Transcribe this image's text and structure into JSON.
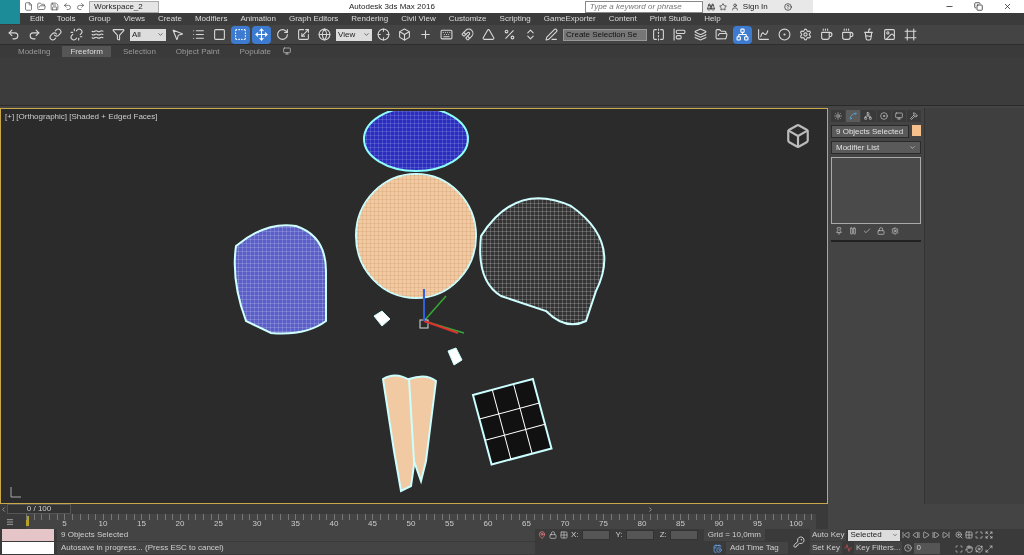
{
  "title_bar": {
    "workspace": "Workspace_2",
    "title": "Autodesk 3ds Max 2016",
    "search_placeholder": "Type a keyword or phrase",
    "sign_in": "Sign In"
  },
  "menu": [
    "Edit",
    "Tools",
    "Group",
    "Views",
    "Create",
    "Modifiers",
    "Animation",
    "Graph Editors",
    "Rendering",
    "Civil View",
    "Customize",
    "Scripting",
    "GameExporter",
    "Content",
    "Print Studio",
    "Help"
  ],
  "toolbar": {
    "selection_filter": "All",
    "reference_coord": "View",
    "selection_set": "Create Selection Se",
    "tools": [
      {
        "kind": "undo",
        "selected": false
      },
      {
        "kind": "redo",
        "selected": false
      },
      {
        "kind": "link",
        "selected": false
      },
      {
        "kind": "unlink",
        "selected": false
      },
      {
        "kind": "bind",
        "selected": false
      },
      {
        "kind": "filter",
        "selected": false
      },
      {
        "kind": "select",
        "selected": false
      },
      {
        "kind": "list",
        "selected": false
      },
      {
        "kind": "region",
        "selected": false
      },
      {
        "kind": "window",
        "selected": true
      },
      {
        "kind": "move",
        "selected": true
      },
      {
        "kind": "rotate",
        "selected": false
      },
      {
        "kind": "scale",
        "selected": false
      },
      {
        "kind": "place",
        "selected": false
      },
      {
        "kind": "coord",
        "selected": false
      },
      {
        "kind": "pivot",
        "selected": false
      },
      {
        "kind": "manip",
        "selected": false
      },
      {
        "kind": "keyboard",
        "selected": false
      },
      {
        "kind": "snap",
        "selected": false
      },
      {
        "kind": "angle",
        "selected": false
      },
      {
        "kind": "percent",
        "selected": false
      },
      {
        "kind": "spinner",
        "selected": false
      },
      {
        "kind": "edit",
        "selected": false
      },
      {
        "kind": "mirror",
        "selected": false
      },
      {
        "kind": "align",
        "selected": false
      },
      {
        "kind": "layers",
        "selected": false
      },
      {
        "kind": "explorer",
        "selected": false
      },
      {
        "kind": "schematic",
        "selected": true
      },
      {
        "kind": "curve",
        "selected": false
      },
      {
        "kind": "material",
        "selected": false
      },
      {
        "kind": "render_setup",
        "selected": false
      },
      {
        "kind": "render",
        "selected": false
      },
      {
        "kind": "render2",
        "selected": false
      },
      {
        "kind": "render3",
        "selected": false
      },
      {
        "kind": "render4",
        "selected": false
      },
      {
        "kind": "frame",
        "selected": false
      }
    ]
  },
  "ribbon_tabs": [
    {
      "label": "Modeling",
      "selected": false
    },
    {
      "label": "Freeform",
      "selected": true
    },
    {
      "label": "Selection",
      "selected": false
    },
    {
      "label": "Object Paint",
      "selected": false
    },
    {
      "label": "Populate",
      "selected": false
    }
  ],
  "viewport": {
    "label": "[+] [Orthographic] [Shaded + Edged Faces]"
  },
  "command_panel": {
    "tabs": [
      {
        "kind": "create",
        "selected": false
      },
      {
        "kind": "modify",
        "selected": true
      },
      {
        "kind": "hierarchy",
        "selected": false
      },
      {
        "kind": "motion",
        "selected": false
      },
      {
        "kind": "display",
        "selected": false
      },
      {
        "kind": "utilities",
        "selected": false
      }
    ],
    "object_name": "9 Objects Selected",
    "modifier_list": "Modifier List"
  },
  "timeline": {
    "frame": "0 / 100",
    "ticks": [
      "5",
      "10",
      "15",
      "20",
      "25",
      "30",
      "35",
      "40",
      "45",
      "50",
      "55",
      "60",
      "65",
      "70",
      "75",
      "80",
      "85",
      "90",
      "95",
      "100"
    ],
    "level": 0
  },
  "status": {
    "selection": "9 Objects Selected",
    "prompt": "Autosave in progress... (Press ESC to cancel)",
    "x_label": "X:",
    "y_label": "Y:",
    "z_label": "Z:",
    "grid": "Grid = 10,0mm",
    "add_time_tag": "Add Time Tag",
    "auto_key": "Auto Key",
    "set_key": "Set Key",
    "key_mode": "Selected",
    "key_filters": "Key Filters...",
    "current_frame": "0"
  }
}
